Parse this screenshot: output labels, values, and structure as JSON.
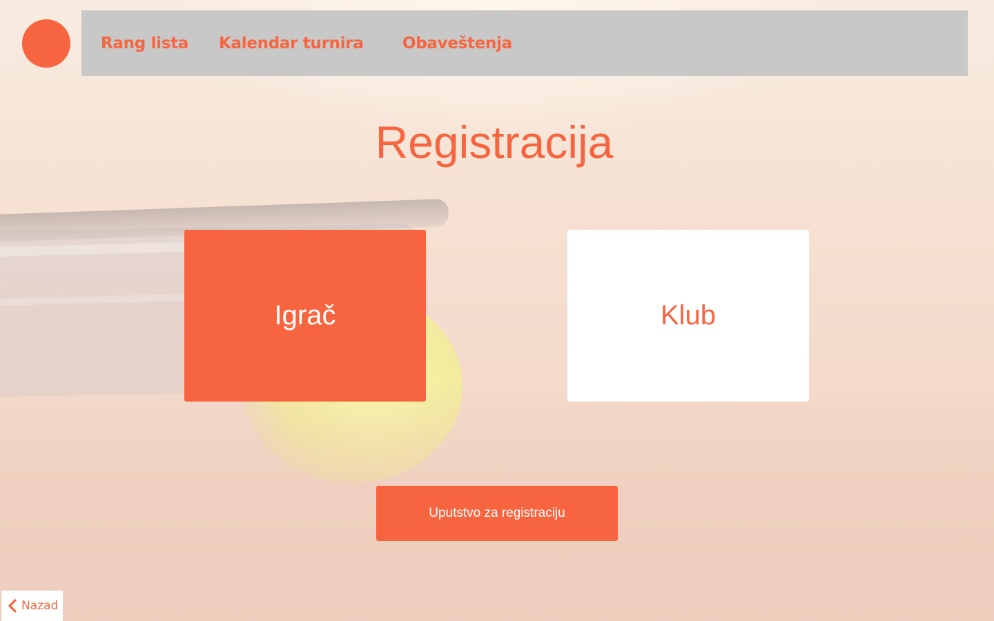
{
  "nav": {
    "items": [
      {
        "label": "Rang lista"
      },
      {
        "label": "Kalendar turnira"
      },
      {
        "label": "Obaveštenja"
      }
    ]
  },
  "main": {
    "title": "Registracija",
    "options": {
      "player": "Igrač",
      "club": "Klub"
    },
    "guide_button": "Uputstvo za registraciju"
  },
  "footer": {
    "back_label": "Nazad",
    "back_icon": "chevron-left-icon"
  },
  "colors": {
    "accent": "#f76540",
    "navbar_bg": "#c8c8c8",
    "card_white": "#ffffff"
  }
}
